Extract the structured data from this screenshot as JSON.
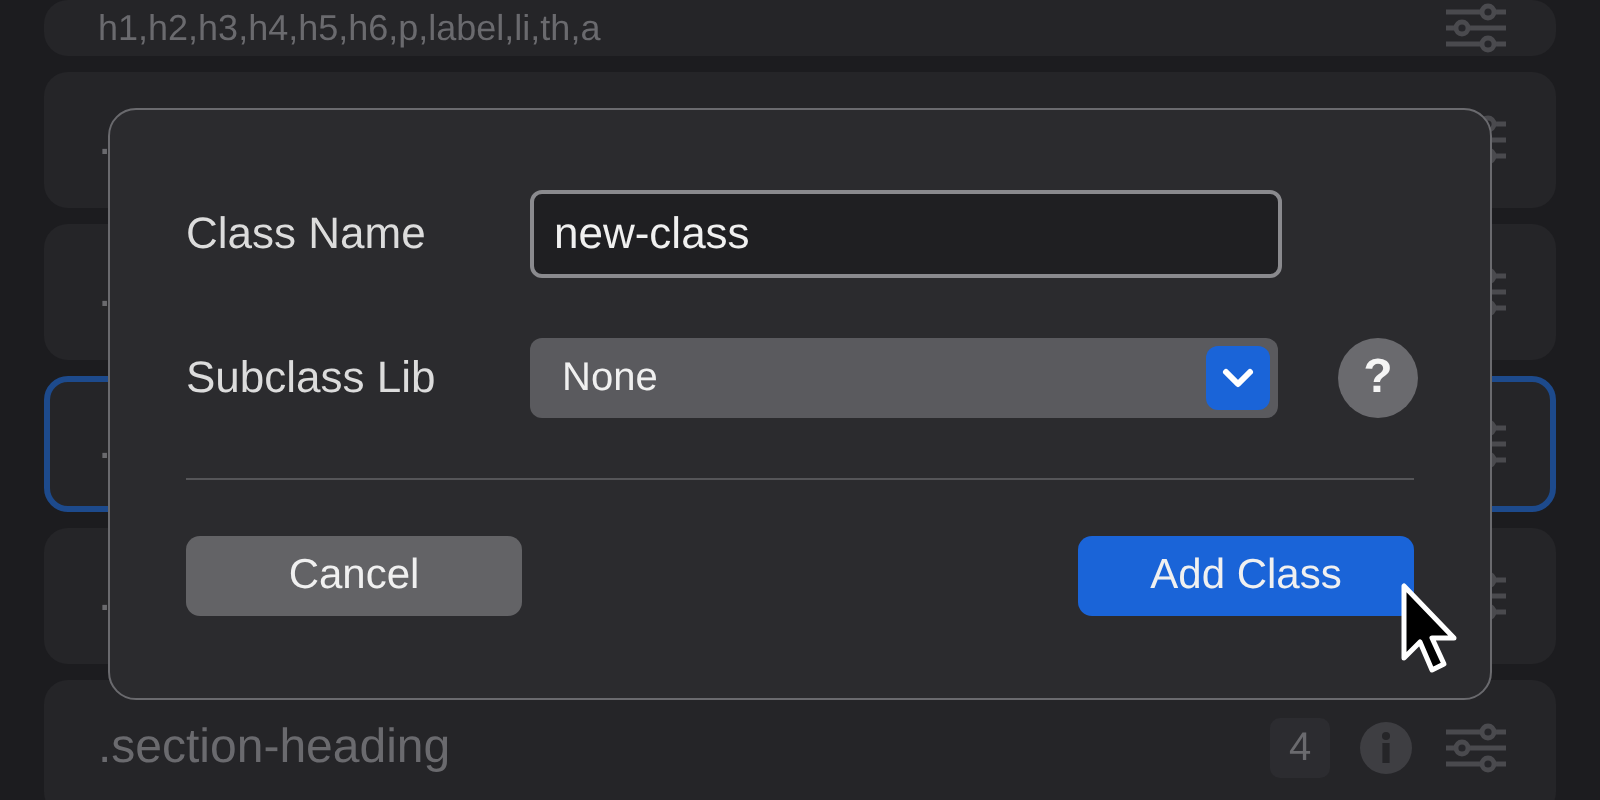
{
  "rules": [
    {
      "name": "h1,h2,h3,h4,h5,h6,p,label,li,th,a",
      "selected": false
    },
    {
      "name": ".",
      "selected": false
    },
    {
      "name": ".",
      "selected": false
    },
    {
      "name": ".",
      "selected": true
    },
    {
      "name": ".",
      "selected": false
    },
    {
      "name": ".section-heading",
      "selected": false,
      "count": "4"
    }
  ],
  "dialog": {
    "fields": [
      {
        "kind": "text",
        "label": "Class Name",
        "value": "new-class"
      },
      {
        "kind": "select",
        "label": "Subclass Lib",
        "value": "None",
        "help": "?"
      }
    ],
    "buttons": [
      {
        "label": "Cancel",
        "kind": "secondary"
      },
      {
        "label": "Add Class",
        "kind": "primary"
      }
    ]
  }
}
